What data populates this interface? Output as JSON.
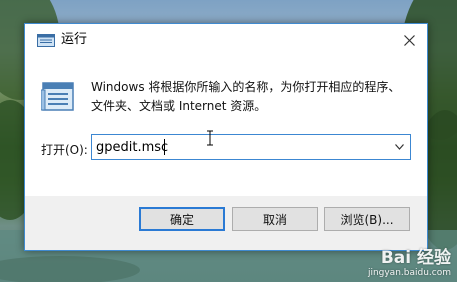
{
  "dialog": {
    "title": "运行",
    "description": "Windows 将根据你所输入的名称，为你打开相应的程序、文件夹、文档或 Internet 资源。",
    "open_label": "打开(O):",
    "open_value": "gpedit.msc",
    "buttons": {
      "ok": "确定",
      "cancel": "取消",
      "browse": "浏览(B)..."
    },
    "icons": {
      "title": "run-icon",
      "close": "close-icon",
      "main": "run-icon",
      "dropdown": "chevron-down-icon"
    }
  },
  "watermark": {
    "logo": "Bai 经验",
    "url": "jingyan.baidu.com"
  },
  "colors": {
    "accent": "#2a7ad4",
    "button_face": "#e1e1e1",
    "button_bar": "#f0f0f0"
  }
}
